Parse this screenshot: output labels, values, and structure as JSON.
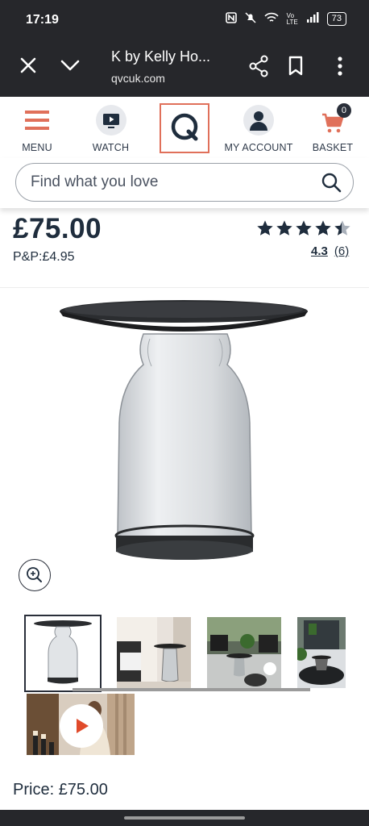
{
  "status_bar": {
    "time": "17:19",
    "battery": "73"
  },
  "browser": {
    "title": "K by Kelly Ho...",
    "url": "qvcuk.com",
    "icons": [
      "close-icon",
      "chevron-down-icon",
      "share-icon",
      "bookmark-icon",
      "more-vert-icon"
    ]
  },
  "nav": {
    "menu_label": "MENU",
    "watch_label": "WATCH",
    "account_label": "MY ACCOUNT",
    "basket_label": "BASKET",
    "basket_count": "0",
    "accent_color": "#e0705a"
  },
  "search": {
    "placeholder": "Find what you love"
  },
  "product": {
    "price": "£75.00",
    "postage": "P&P:£4.95",
    "rating_value": "4.3",
    "review_count": "(6)",
    "stars_filled": 4.3,
    "bottom_price_label": "Price:",
    "bottom_price_value": "£75.00"
  },
  "gallery": {
    "thumbnails": [
      "side-table-product-thumb",
      "side-table-room-thumb",
      "patio-table-thumb",
      "patio-outdoor-thumb"
    ],
    "video": "product-video-thumb"
  }
}
